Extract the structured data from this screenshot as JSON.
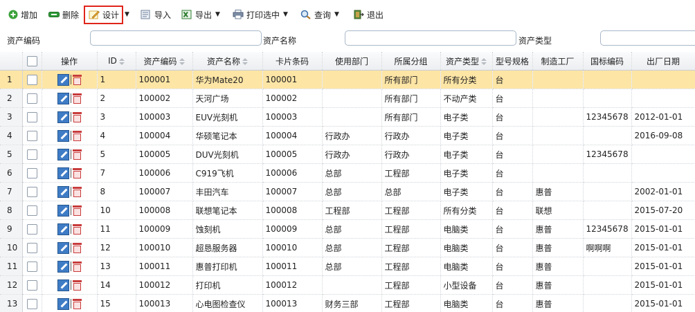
{
  "toolbar": {
    "add": "增加",
    "delete": "删除",
    "design": "设计",
    "import": "导入",
    "export": "导出",
    "print": "打印选中",
    "query": "查询",
    "exit": "退出",
    "icons": [
      "plus-circle-icon",
      "minus-icon",
      "pencil-icon",
      "import-icon",
      "excel-icon",
      "printer-icon",
      "magnifier-icon",
      "exit-door-icon"
    ]
  },
  "search": {
    "code_label": "资产编码",
    "code_value": "",
    "name_label": "资产名称",
    "name_value": "",
    "type_label": "资产类型",
    "type_value": ""
  },
  "grid": {
    "headers": {
      "ops": "操作",
      "id": "ID",
      "code": "资产编码",
      "name": "资产名称",
      "card": "卡片条码",
      "dept": "使用部门",
      "group": "所属分组",
      "type": "资产类型",
      "model": "型号规格",
      "maker": "制造工厂",
      "intl": "国标编码",
      "date": "出厂日期"
    },
    "rows": [
      {
        "n": "1",
        "id": "1",
        "code": "100001",
        "name": "华为Mate20",
        "card": "100001",
        "dept": "",
        "group": "所有部门",
        "type": "所有分类",
        "model": "台",
        "maker": "",
        "intl": "",
        "date": ""
      },
      {
        "n": "2",
        "id": "2",
        "code": "100002",
        "name": "天河广场",
        "card": "100002",
        "dept": "",
        "group": "所有部门",
        "type": "不动产类",
        "model": "台",
        "maker": "",
        "intl": "",
        "date": ""
      },
      {
        "n": "3",
        "id": "3",
        "code": "100003",
        "name": "EUV光刻机",
        "card": "100003",
        "dept": "",
        "group": "所有部门",
        "type": "电子类",
        "model": "台",
        "maker": "",
        "intl": "12345678",
        "date": "2012-01-01"
      },
      {
        "n": "4",
        "id": "4",
        "code": "100004",
        "name": "华硕笔记本",
        "card": "100004",
        "dept": "行政办",
        "group": "行政办",
        "type": "电子类",
        "model": "台",
        "maker": "",
        "intl": "",
        "date": "2016-09-08"
      },
      {
        "n": "5",
        "id": "5",
        "code": "100005",
        "name": "DUV光刻机",
        "card": "100005",
        "dept": "行政办",
        "group": "行政办",
        "type": "电子类",
        "model": "台",
        "maker": "",
        "intl": "12345678",
        "date": ""
      },
      {
        "n": "6",
        "id": "7",
        "code": "100006",
        "name": "C919飞机",
        "card": "100006",
        "dept": "总部",
        "group": "工程部",
        "type": "电子类",
        "model": "台",
        "maker": "",
        "intl": "",
        "date": ""
      },
      {
        "n": "7",
        "id": "8",
        "code": "100007",
        "name": "丰田汽车",
        "card": "100007",
        "dept": "总部",
        "group": "总部",
        "type": "电子类",
        "model": "台",
        "maker": "惠普",
        "intl": "",
        "date": "2002-01-01"
      },
      {
        "n": "8",
        "id": "10",
        "code": "100008",
        "name": "联想笔记本",
        "card": "100008",
        "dept": "工程部",
        "group": "工程部",
        "type": "所有分类",
        "model": "台",
        "maker": "联想",
        "intl": "",
        "date": "2015-07-20"
      },
      {
        "n": "9",
        "id": "11",
        "code": "100009",
        "name": "蚀刻机",
        "card": "100009",
        "dept": "总部",
        "group": "工程部",
        "type": "电脑类",
        "model": "台",
        "maker": "惠普",
        "intl": "12345678",
        "date": "2015-01-01"
      },
      {
        "n": "10",
        "id": "12",
        "code": "100010",
        "name": "超恳服务器",
        "card": "100010",
        "dept": "总部",
        "group": "工程部",
        "type": "电脑类",
        "model": "台",
        "maker": "惠普",
        "intl": "啊啊啊",
        "date": "2015-01-01"
      },
      {
        "n": "11",
        "id": "13",
        "code": "100011",
        "name": "惠普打印机",
        "card": "100011",
        "dept": "总部",
        "group": "工程部",
        "type": "电脑类",
        "model": "台",
        "maker": "惠普",
        "intl": "",
        "date": "2015-01-01"
      },
      {
        "n": "12",
        "id": "14",
        "code": "100012",
        "name": "打印机",
        "card": "100012",
        "dept": "",
        "group": "工程部",
        "type": "小型设备",
        "model": "台",
        "maker": "惠普",
        "intl": "",
        "date": "2015-01-01"
      },
      {
        "n": "13",
        "id": "15",
        "code": "100013",
        "name": "心电图检查仪",
        "card": "100013",
        "dept": "财务三部",
        "group": "工程部",
        "type": "电脑类",
        "model": "台",
        "maker": "惠普",
        "intl": "",
        "date": "2015-01-01"
      }
    ]
  },
  "colors": {
    "selected_row": "#fde5a5",
    "highlight_box": "#e0241b",
    "header_bg": "#eceef1"
  }
}
